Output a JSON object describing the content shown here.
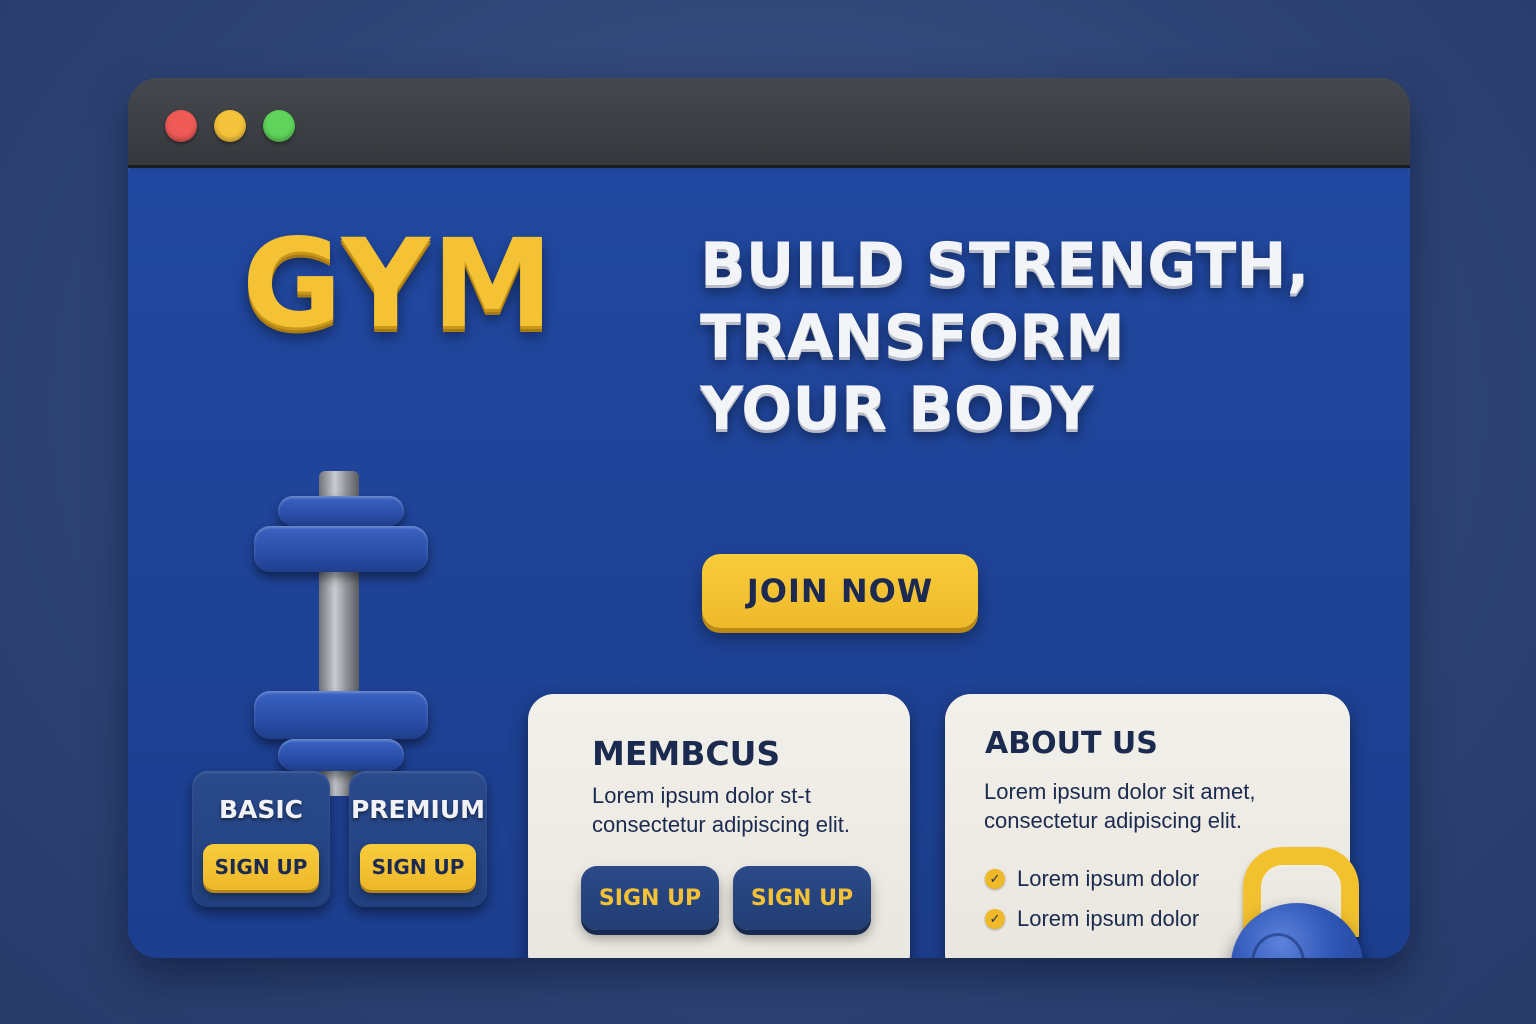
{
  "window": {
    "controls": [
      "close",
      "minimize",
      "maximize"
    ]
  },
  "logo": "GYM",
  "hero": {
    "headline_lines": [
      "BUILD STRENGTH,",
      "TRANSFORM",
      "YOUR BODY"
    ],
    "cta_label": "JOIN NOW"
  },
  "plans": [
    {
      "title": "BASIC",
      "button": "SIGN UP"
    },
    {
      "title": "PREMIUM",
      "button": "SIGN UP"
    }
  ],
  "members_card": {
    "title": "MEMBCUS",
    "body_lines": [
      "Lorem ipsum dolor st-t",
      "consectetur adipiscing elit."
    ],
    "buttons": [
      "SIGN UP",
      "SIGN UP"
    ]
  },
  "about_card": {
    "title": "ABOUT US",
    "body_lines": [
      "Lorem ipsum dolor  sit amet,",
      "consectetur adipiscing elit."
    ],
    "bullets": [
      "Lorem ipsum dolor",
      "Lorem ipsum dolor"
    ]
  },
  "colors": {
    "accent": "#f4c234",
    "brand_blue": "#1f4396",
    "dark_text": "#1b2a4f",
    "card_bg": "#f2f0ea"
  },
  "icons": [
    "dumbbell-icon",
    "kettlebell-icon",
    "check-icon"
  ]
}
